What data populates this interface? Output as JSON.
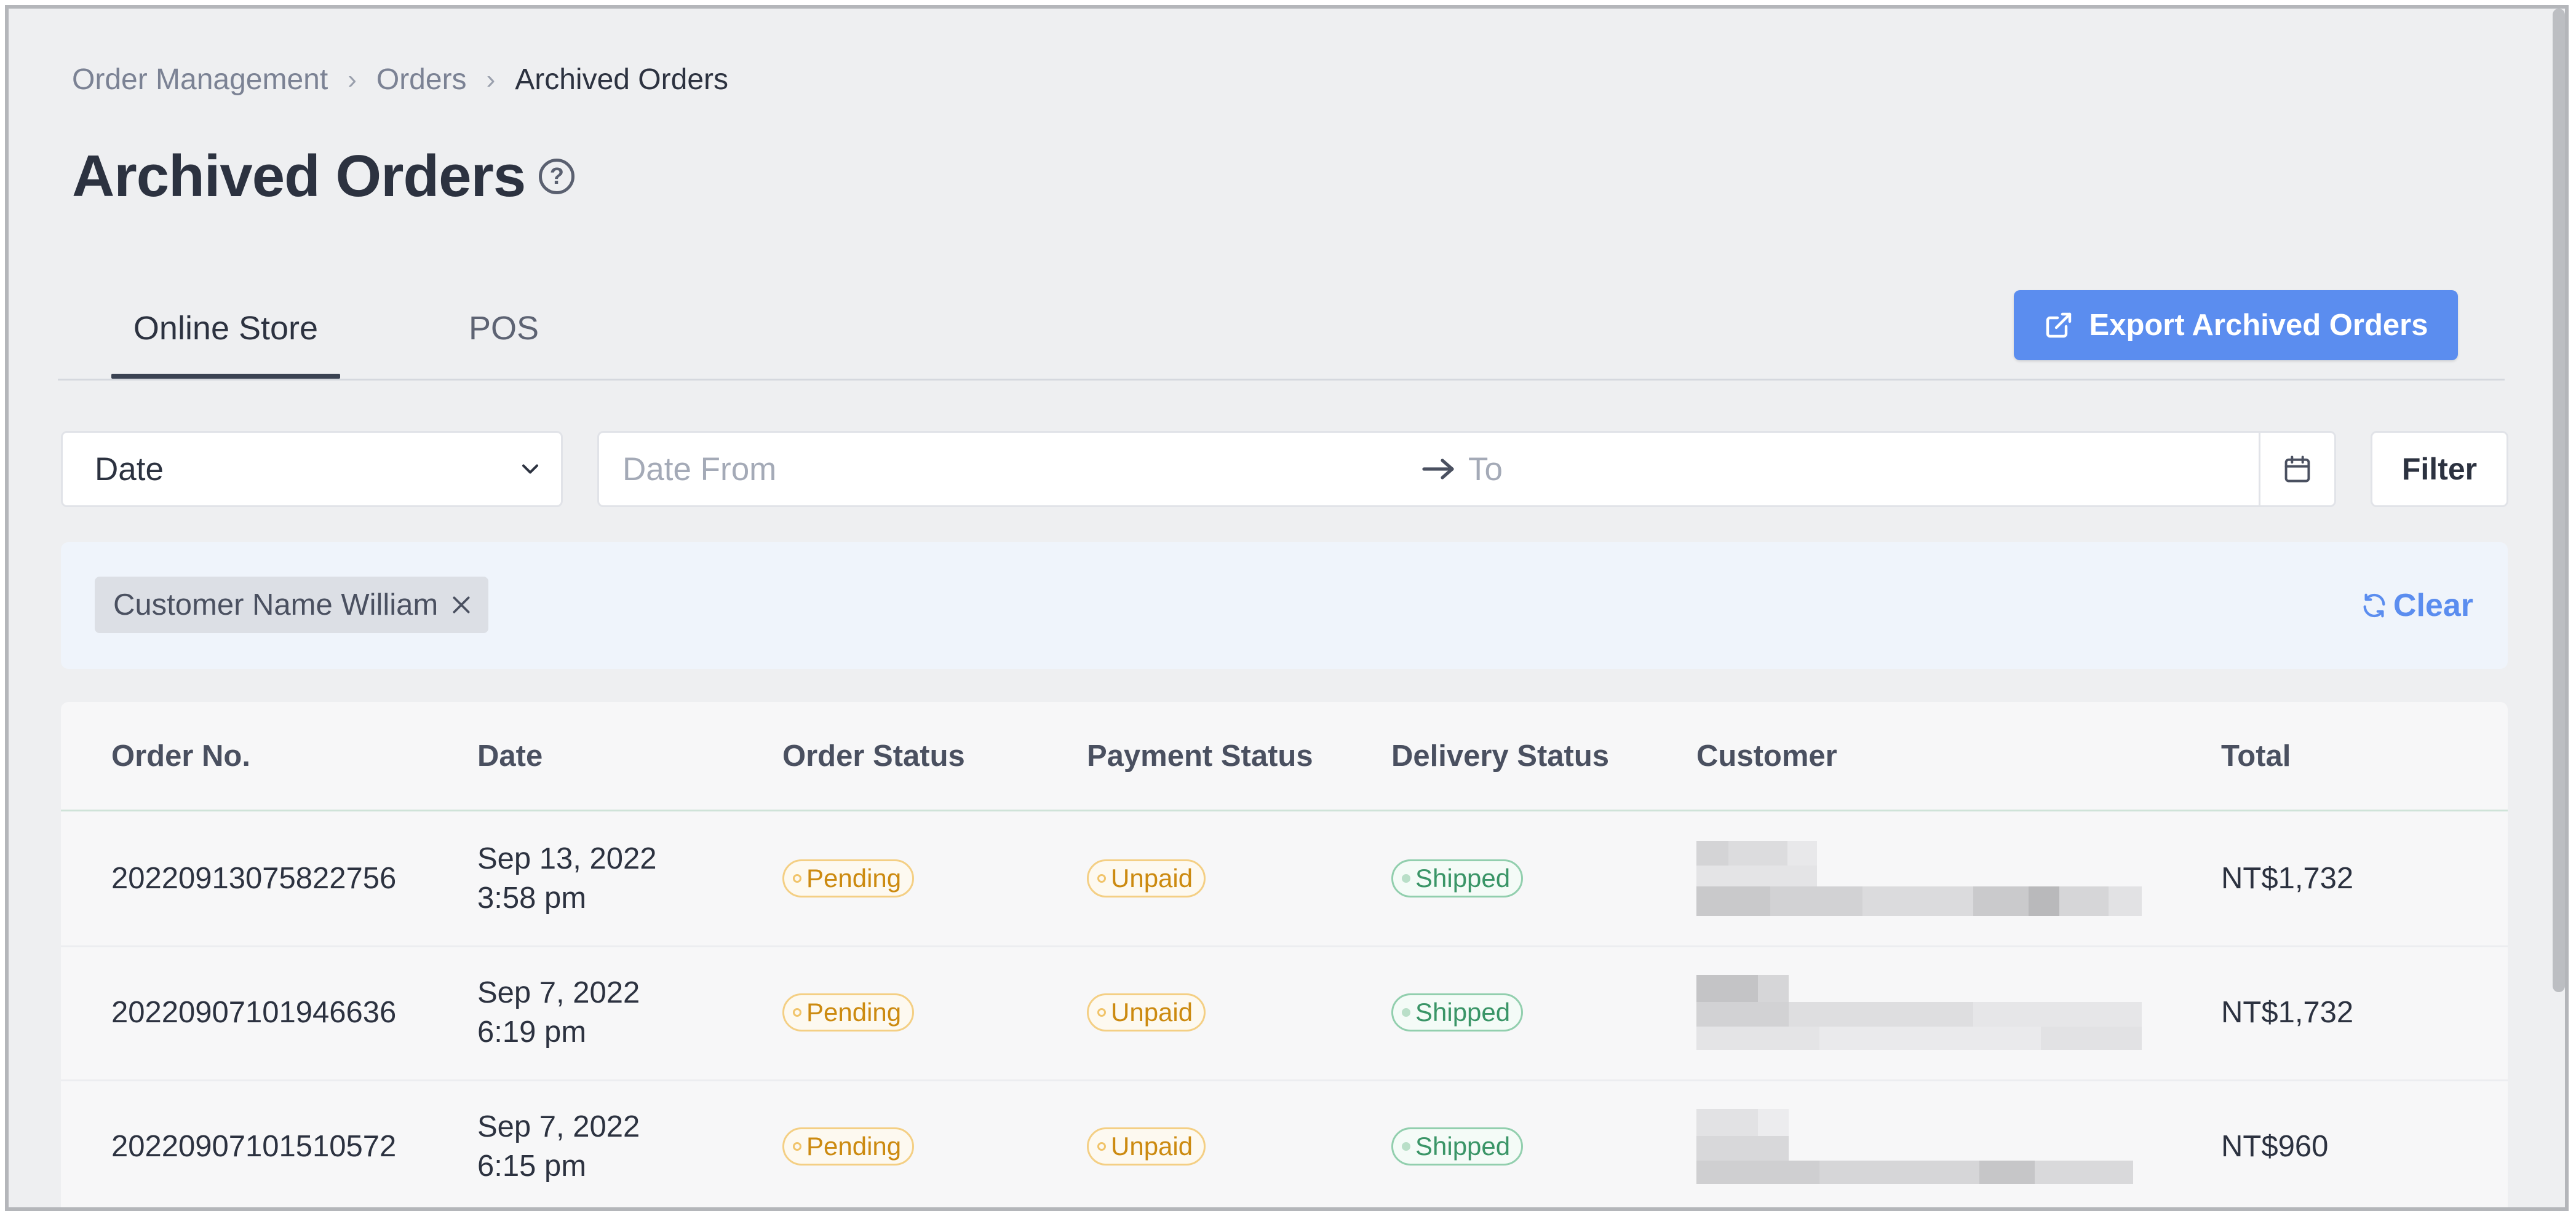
{
  "breadcrumb": {
    "items": [
      "Order Management",
      "Orders"
    ],
    "current": "Archived Orders"
  },
  "page": {
    "title": "Archived Orders",
    "help_icon": "question-circle-icon"
  },
  "tabs": [
    {
      "label": "Online Store",
      "active": true
    },
    {
      "label": "POS",
      "active": false
    }
  ],
  "export_button": {
    "label": "Export Archived Orders",
    "icon": "external-link-icon",
    "color": "#5b8def"
  },
  "filters": {
    "field_select": "Date",
    "date_from_placeholder": "Date From",
    "date_to_placeholder": "To",
    "filter_label": "Filter"
  },
  "active_filters": {
    "chips": [
      {
        "label": "Customer Name William"
      }
    ],
    "clear_label": "Clear"
  },
  "table": {
    "columns": [
      "Order No.",
      "Date",
      "Order Status",
      "Payment Status",
      "Delivery Status",
      "Customer",
      "Total"
    ],
    "rows": [
      {
        "order_no": "20220913075822756",
        "date": "Sep 13, 2022",
        "time": "3:58 pm",
        "order_status": "Pending",
        "payment_status": "Unpaid",
        "delivery_status": "Shipped",
        "total": "NT$1,732"
      },
      {
        "order_no": "20220907101946636",
        "date": "Sep 7, 2022",
        "time": "6:19 pm",
        "order_status": "Pending",
        "payment_status": "Unpaid",
        "delivery_status": "Shipped",
        "total": "NT$1,732"
      },
      {
        "order_no": "20220907101510572",
        "date": "Sep 7, 2022",
        "time": "6:15 pm",
        "order_status": "Pending",
        "payment_status": "Unpaid",
        "delivery_status": "Shipped",
        "total": "NT$960"
      }
    ]
  },
  "colors": {
    "pending": "#cc8a10",
    "unpaid": "#cc8a10",
    "shipped": "#3a9567",
    "accent": "#5b8def"
  }
}
